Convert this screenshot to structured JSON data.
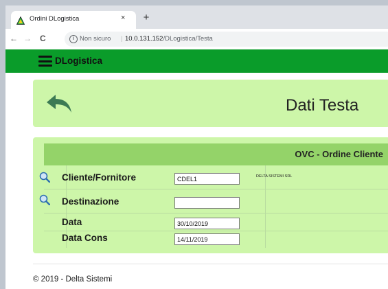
{
  "browser": {
    "tab_title": "Ordini DLogistica",
    "tab_close": "×",
    "new_tab": "+",
    "security_label": "Non sicuro",
    "url_host": "10.0.131.152",
    "url_path": "/DLogistica/Testa",
    "back": "←",
    "forward": "→",
    "reload": "C"
  },
  "navbar": {
    "brand": "DLogistica",
    "color": "#0a9c2a"
  },
  "header": {
    "title": "Dati Testa",
    "back_icon": "undo-arrow-icon"
  },
  "form": {
    "section_title": "OVC - Ordine Cliente",
    "rows": [
      {
        "label": "Cliente/Fornitore",
        "value": "CDEL1",
        "description": "DELTA SISTEMI SRL",
        "lookup": true
      },
      {
        "label": "Destinazione",
        "value": "",
        "description": "",
        "lookup": true
      },
      {
        "label": "Data",
        "value": "30/10/2019",
        "description": "",
        "lookup": false
      },
      {
        "label": "Data Cons",
        "value": "14/11/2019",
        "description": "",
        "lookup": false
      }
    ]
  },
  "footer": {
    "text": "© 2019 - Delta Sistemi"
  },
  "colors": {
    "card_bg": "#cdf6a9",
    "section_header_bg": "#94d369"
  }
}
